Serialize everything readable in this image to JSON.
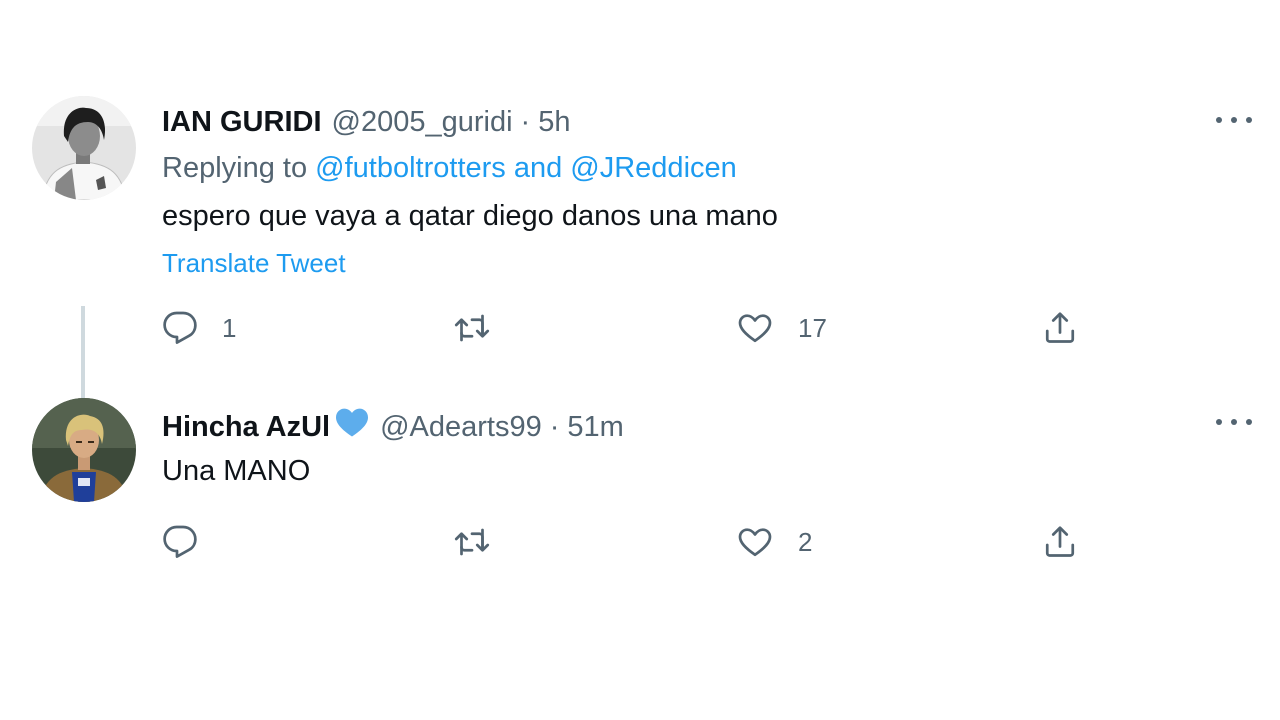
{
  "tweets": [
    {
      "display_name": "IAN GURIDI",
      "handle": "@2005_guridi",
      "separator": "·",
      "time": "5h",
      "replying_prefix": "Replying to",
      "replying_mention_1": "@futboltrotters",
      "replying_and": "and",
      "replying_mention_2": "@JReddicen",
      "text": "espero que vaya a qatar diego danos una mano",
      "translate_label": "Translate Tweet",
      "reply_count": "1",
      "retweet_count": "",
      "like_count": "17"
    },
    {
      "display_name": "Hincha AzUl",
      "name_emoji": "blue-heart",
      "handle": "@Adearts99",
      "separator": "·",
      "time": "51m",
      "text": "Una MANO",
      "reply_count": "",
      "retweet_count": "",
      "like_count": "2"
    }
  ],
  "icons": {
    "reply": "reply-icon",
    "retweet": "retweet-icon",
    "like": "heart-icon",
    "share": "share-icon",
    "more": "more-icon"
  },
  "colors": {
    "link": "#1d9bf0",
    "secondary_text": "#536471",
    "primary_text": "#0f1419",
    "thread_line": "#cfd9de",
    "heart_emoji": "#5dadec"
  }
}
